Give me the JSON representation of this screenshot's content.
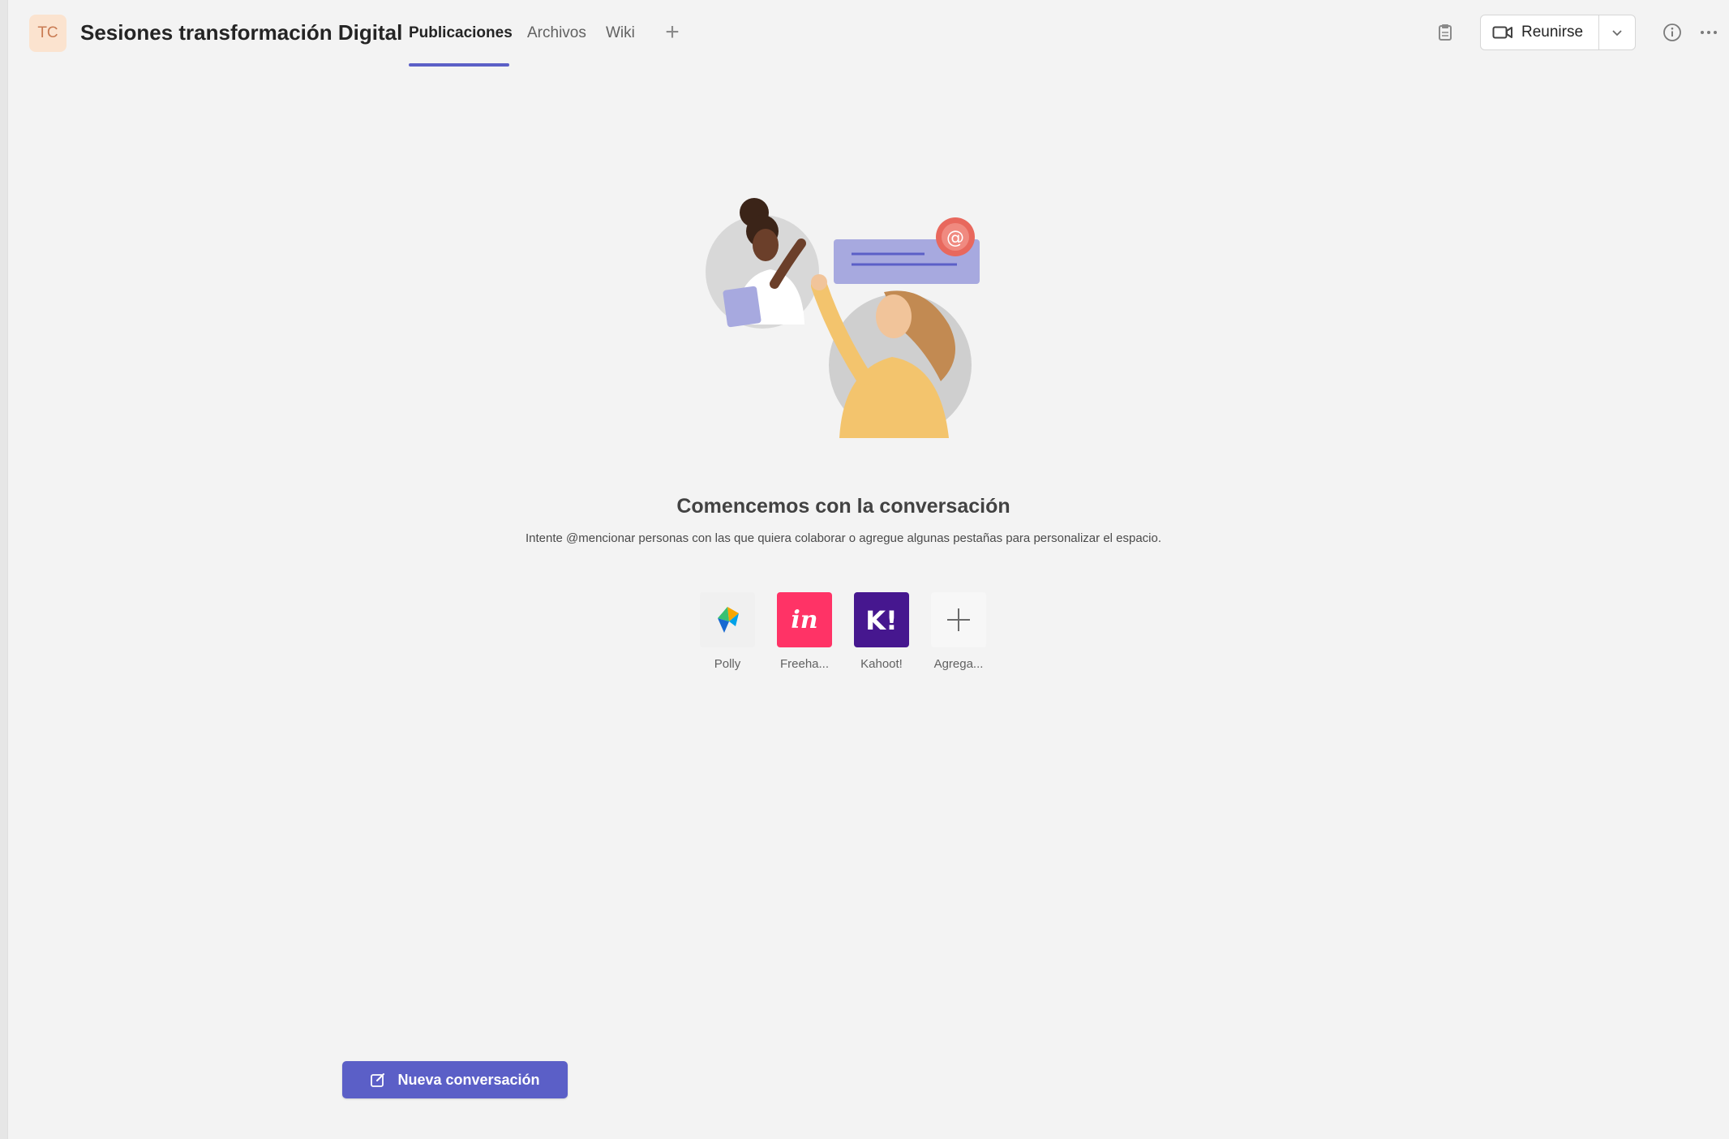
{
  "header": {
    "team_initials": "TC",
    "channel_title": "Sesiones transformación Digital",
    "tabs": [
      {
        "label": "Publicaciones",
        "active": true
      },
      {
        "label": "Archivos",
        "active": false
      },
      {
        "label": "Wiki",
        "active": false
      }
    ],
    "add_tab_icon": "plus-icon",
    "meet_label": "Reunirse",
    "meet_icon": "video-camera-icon",
    "actions_icons": [
      "clipboard-icon",
      "info-icon",
      "more-icon"
    ]
  },
  "empty_state": {
    "title": "Comencemos con la conversación",
    "subtitle": "Intente @mencionar personas con las que quiera colaborar o agregue algunas pestañas para personalizar el espacio.",
    "illustration_icon": "collaboration-illustration"
  },
  "apps": [
    {
      "label": "Polly",
      "icon": "polly-icon",
      "color": "#f0f0f0"
    },
    {
      "label": "Freeha...",
      "icon": "freehand-icon",
      "color": "#ff3366"
    },
    {
      "label": "Kahoot!",
      "icon": "kahoot-icon",
      "color": "#46178f"
    },
    {
      "label": "Agrega...",
      "icon": "plus-icon",
      "color": "#f7f7f7"
    }
  ],
  "new_conversation": {
    "label": "Nueva conversación",
    "icon": "compose-icon"
  },
  "colors": {
    "accent": "#5b5fc7",
    "background": "#f3f3f3"
  }
}
